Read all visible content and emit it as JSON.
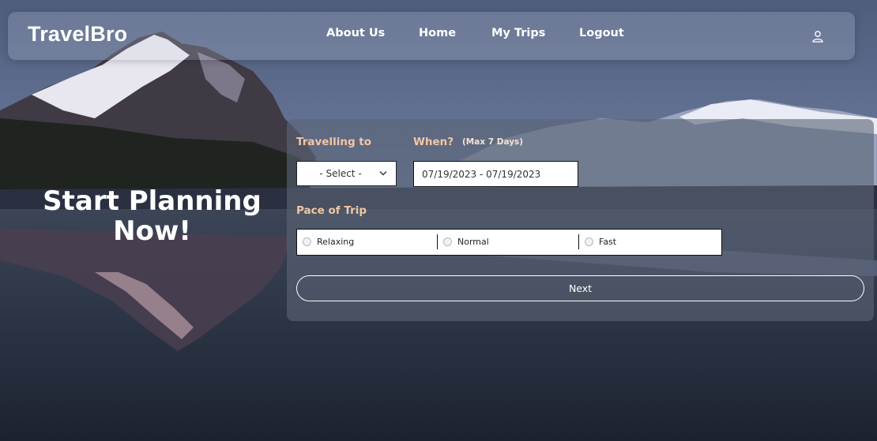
{
  "nav": {
    "brand": "TravelBro",
    "links": [
      "About Us",
      "Home",
      "My Trips",
      "Logout"
    ],
    "user_icon": "user-icon"
  },
  "hero": {
    "line1": "Start Planning",
    "line2": "Now!"
  },
  "form": {
    "destination": {
      "label": "Travelling to",
      "selected": "- Select -"
    },
    "when": {
      "label": "When?",
      "sublabel": "(Max 7 Days)",
      "value": "07/19/2023 - 07/19/2023"
    },
    "pace": {
      "label": "Pace of Trip",
      "options": [
        "Relaxing",
        "Normal",
        "Fast"
      ]
    },
    "next_label": "Next"
  },
  "colors": {
    "label_accent": "#f3c6a2",
    "panel_bg": "#5a6476",
    "sky": "#4b5b7a"
  }
}
